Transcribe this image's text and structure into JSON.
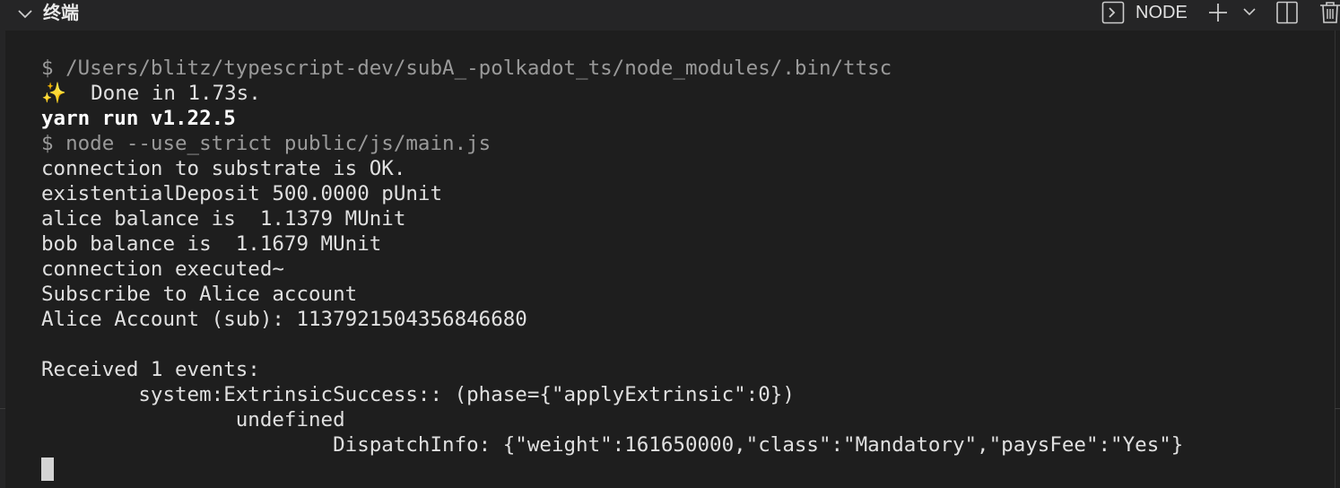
{
  "panel": {
    "title": "终端",
    "terminal_name": "NODE",
    "icons": {
      "collapse": "chevron-down-icon",
      "terminal": "terminal-icon",
      "new_terminal": "plus-icon",
      "dropdown": "chevron-down-icon",
      "split": "split-icon",
      "kill": "trash-icon"
    }
  },
  "terminal": {
    "lines": [
      {
        "text": "$ /Users/blitz/typescript-dev/subA_-polkadot_ts/node_modules/.bin/ttsc",
        "style": "dim"
      },
      {
        "icon": "✨",
        "text": "  Done in 1.73s.",
        "style": "normal"
      },
      {
        "text": "yarn run v1.22.5",
        "style": "bold"
      },
      {
        "text": "$ node --use_strict public/js/main.js",
        "style": "dim"
      },
      {
        "text": "connection to substrate is OK.",
        "style": "normal"
      },
      {
        "text": "existentialDeposit 500.0000 pUnit",
        "style": "normal"
      },
      {
        "text": "alice balance is  1.1379 MUnit",
        "style": "normal"
      },
      {
        "text": "bob balance is  1.1679 MUnit",
        "style": "normal"
      },
      {
        "text": "connection executed~",
        "style": "normal"
      },
      {
        "text": "Subscribe to Alice account",
        "style": "normal"
      },
      {
        "text": "Alice Account (sub): 1137921504356846680",
        "style": "normal"
      },
      {
        "text": "",
        "style": "normal"
      },
      {
        "text": "Received 1 events:",
        "style": "normal"
      },
      {
        "text": "        system:ExtrinsicSuccess:: (phase={\"applyExtrinsic\":0})",
        "style": "normal"
      },
      {
        "text": "                undefined",
        "style": "normal"
      },
      {
        "text": "                        DispatchInfo: {\"weight\":161650000,\"class\":\"Mandatory\",\"paysFee\":\"Yes\"}",
        "style": "normal"
      }
    ]
  },
  "colors": {
    "background": "#1e1e1e",
    "header": "#252526",
    "text": "#e0e0e0",
    "dim_text": "#9a9a9a",
    "sparkle": "#f3d34a"
  }
}
